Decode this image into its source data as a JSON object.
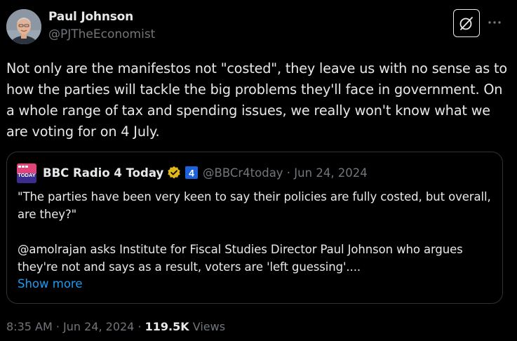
{
  "author": {
    "name": "Paul Johnson",
    "handle": "@PJTheEconomist"
  },
  "tweet": {
    "text": "Not only are the manifestos not \"costed\", they leave us with no sense as to how the parties will tackle the big problems they'll face in government. On a whole range of tax and spending issues, we really won't know what we are voting for on 4 July."
  },
  "header": {
    "grok_icon": "grok-icon",
    "more_icon": "more-horizontal-icon"
  },
  "quote": {
    "author_name": "BBC Radio 4 Today",
    "avatar_text": "TODAY",
    "badge_number": "4",
    "meta": "@BBCr4today · Jun 24, 2024",
    "paragraph_1": "\"The parties have been very keen to say their policies are fully costed, but overall, are they?\"",
    "paragraph_2": "@amolrajan asks Institute for Fiscal Studies Director Paul Johnson who argues they're not and says as a result, voters are 'left guessing'....",
    "show_more": "Show more",
    "verified_icon": "verified-gold-badge-icon"
  },
  "footer": {
    "time_date": "8:35 AM · Jun 24, 2024 · ",
    "views_count": "119.5K",
    "views_label": " Views"
  },
  "colors": {
    "background": "#000000",
    "text": "#e7e9ea",
    "secondary": "#71767b",
    "link": "#1d9bf0",
    "border": "#2f3336",
    "verified_gold": "#e2b719",
    "bbc_blue": "#1d62d8"
  }
}
